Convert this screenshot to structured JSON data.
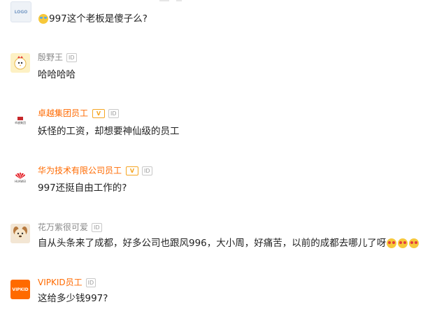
{
  "comments": [
    {
      "author": "",
      "text": "997这个老板是傻子么?",
      "avatar_text": "LOGO"
    },
    {
      "author": "殷野王",
      "text": "哈哈哈哈",
      "id_badge": "ID"
    },
    {
      "author": "卓越集团员工",
      "text": "妖怪的工资，却想要神仙级的员工",
      "v_badge": "V",
      "id_badge": "ID",
      "avatar_text": "卓越集团"
    },
    {
      "author": "华为技术有限公司员工",
      "text": "997还挺自由工作的?",
      "v_badge": "V",
      "id_badge": "ID",
      "avatar_text": "HUAWEI"
    },
    {
      "author": "花万紫很可爱",
      "text": "自从头条来了成都，好多公司也跟风996，大小周，好痛苦，以前的成都去哪儿了呀",
      "id_badge": "ID"
    },
    {
      "author": "VIPKID员工",
      "text": "这给多少钱997?",
      "v_badge": "",
      "id_badge": "ID",
      "avatar_text": "VIPKID"
    }
  ],
  "colors": {
    "org_name": "#ff6a00",
    "plain_name": "#8a8a8a",
    "verified_badge": "#f5a623",
    "text": "#222222"
  },
  "icons": [
    "crying-laughing-emoji",
    "heart-eyes-emoji",
    "rooster-avatar",
    "dog-avatar"
  ]
}
